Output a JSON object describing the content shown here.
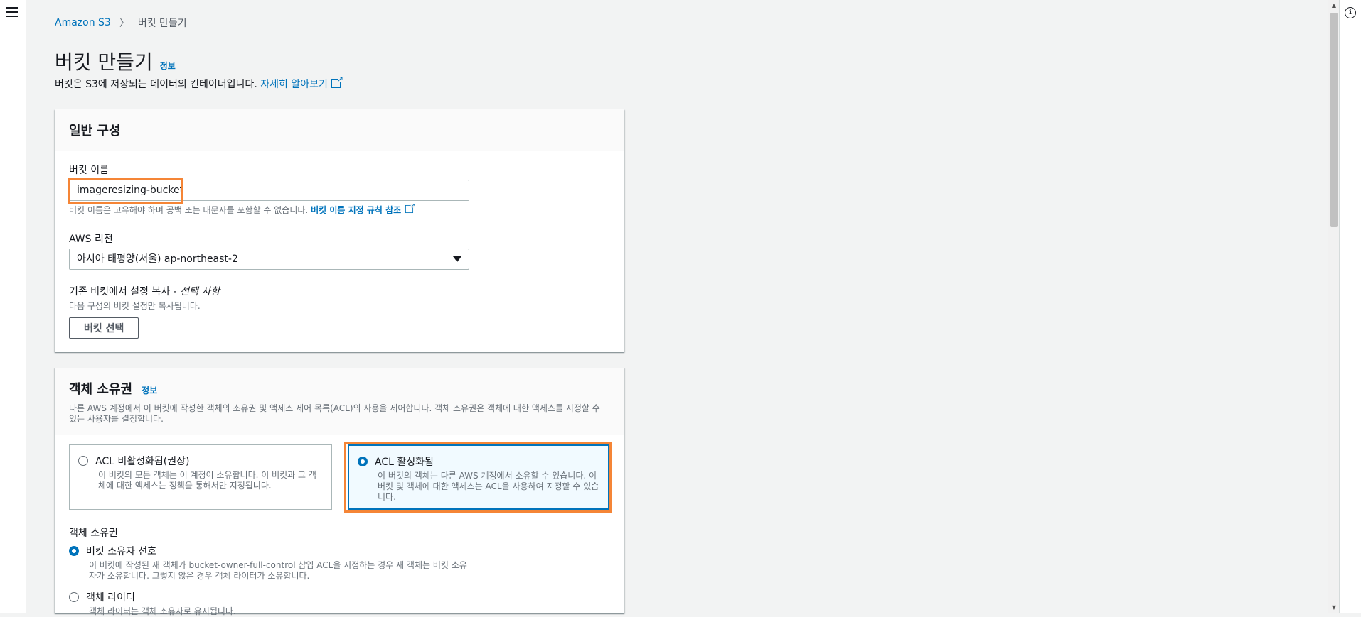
{
  "breadcrumb": {
    "root": "Amazon S3",
    "current": "버킷 만들기"
  },
  "header": {
    "title": "버킷 만들기",
    "info": "정보",
    "subtitle": "버킷은 S3에 저장되는 데이터의 컨테이너입니다.",
    "learn_more": "자세히 알아보기"
  },
  "general": {
    "heading": "일반 구성",
    "bucket_name_label": "버킷 이름",
    "bucket_name_value": "imageresizing-bucket",
    "bucket_name_hint": "버킷 이름은 고유해야 하며 공백 또는 대문자를 포함할 수 없습니다.",
    "bucket_name_rules_link": "버킷 이름 지정 규칙 참조",
    "region_label": "AWS 리전",
    "region_value": "아시아 태평양(서울) ap-northeast-2",
    "copy_label": "기존 버킷에서 설정 복사 -",
    "copy_optional": "선택 사항",
    "copy_hint": "다음 구성의 버킷 설정만 복사됩니다.",
    "choose_bucket_button": "버킷 선택"
  },
  "ownership": {
    "heading": "객체 소유권",
    "info": "정보",
    "desc": "다른 AWS 계정에서 이 버킷에 작성한 객체의 소유권 및 액세스 제어 목록(ACL)의 사용을 제어합니다. 객체 소유권은 객체에 대한 액세스를 지정할 수 있는 사용자를 결정합니다.",
    "acl_disabled_title": "ACL 비활성화됨(권장)",
    "acl_disabled_desc": "이 버킷의 모든 객체는 이 계정이 소유합니다. 이 버킷과 그 객체에 대한 액세스는 정책을 통해서만 지정됩니다.",
    "acl_enabled_title": "ACL 활성화됨",
    "acl_enabled_desc": "이 버킷의 객체는 다른 AWS 계정에서 소유할 수 있습니다. 이 버킷 및 객체에 대한 액세스는 ACL을 사용하여 지정할 수 있습니다.",
    "sub_label": "객체 소유권",
    "opt1_title": "버킷 소유자 선호",
    "opt1_desc": "이 버킷에 작성된 새 객체가 bucket-owner-full-control 삽입 ACL을 지정하는 경우 새 객체는 버킷 소유자가 소유합니다. 그렇지 않은 경우 객체 라이터가 소유합니다.",
    "opt2_title": "객체 라이터",
    "opt2_desc": "객체 라이터는 객체 소유자로 유지됩니다."
  },
  "colors": {
    "link": "#0073bb",
    "highlight": "#f58536"
  },
  "icons": {
    "menu": "menu-icon",
    "info": "info-icon",
    "external": "external-link-icon"
  }
}
